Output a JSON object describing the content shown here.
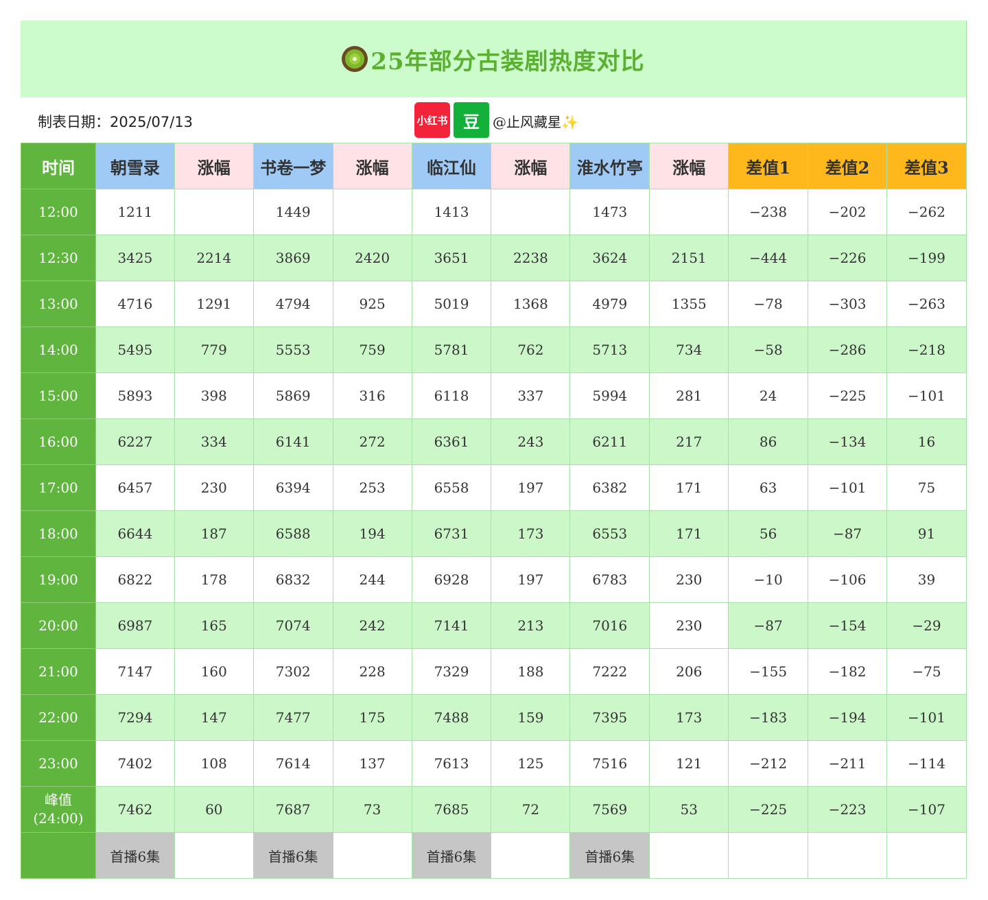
{
  "title": "25年部分古装剧热度对比",
  "date_label": "制表日期：2025/07/13",
  "badges": {
    "xiaohongshu": "小红书",
    "douban": "豆"
  },
  "handle": "@止风藏星",
  "handle_emoji": "✨",
  "colors": {
    "title_band": "#ccfccc",
    "title_text": "#5cb031",
    "time_col": "#5fb53d",
    "drama_header": "#9fcaf6",
    "change_header": "#fde3e5",
    "diff_header": "#ffb81c",
    "alt_row": "#ccf7c9",
    "footer_gray": "#c6c6c6"
  },
  "table": {
    "headers": [
      "时间",
      "朝雪录",
      "涨幅",
      "书卷一梦",
      "涨幅",
      "临江仙",
      "涨幅",
      "淮水竹亭",
      "涨幅",
      "差值1",
      "差值2",
      "差值3"
    ],
    "rows": [
      [
        "12:00",
        "1211",
        "",
        "1449",
        "",
        "1413",
        "",
        "1473",
        "",
        "−238",
        "−202",
        "−262"
      ],
      [
        "12:30",
        "3425",
        "2214",
        "3869",
        "2420",
        "3651",
        "2238",
        "3624",
        "2151",
        "−444",
        "−226",
        "−199"
      ],
      [
        "13:00",
        "4716",
        "1291",
        "4794",
        "925",
        "5019",
        "1368",
        "4979",
        "1355",
        "−78",
        "−303",
        "−263"
      ],
      [
        "14:00",
        "5495",
        "779",
        "5553",
        "759",
        "5781",
        "762",
        "5713",
        "734",
        "−58",
        "−286",
        "−218"
      ],
      [
        "15:00",
        "5893",
        "398",
        "5869",
        "316",
        "6118",
        "337",
        "5994",
        "281",
        "24",
        "−225",
        "−101"
      ],
      [
        "16:00",
        "6227",
        "334",
        "6141",
        "272",
        "6361",
        "243",
        "6211",
        "217",
        "86",
        "−134",
        "16"
      ],
      [
        "17:00",
        "6457",
        "230",
        "6394",
        "253",
        "6558",
        "197",
        "6382",
        "171",
        "63",
        "−101",
        "75"
      ],
      [
        "18:00",
        "6644",
        "187",
        "6588",
        "194",
        "6731",
        "173",
        "6553",
        "171",
        "56",
        "−87",
        "91"
      ],
      [
        "19:00",
        "6822",
        "178",
        "6832",
        "244",
        "6928",
        "197",
        "6783",
        "230",
        "−10",
        "−106",
        "39"
      ],
      [
        "20:00",
        "6987",
        "165",
        "7074",
        "242",
        "7141",
        "213",
        "7016",
        "230",
        "−87",
        "−154",
        "−29"
      ],
      [
        "21:00",
        "7147",
        "160",
        "7302",
        "228",
        "7329",
        "188",
        "7222",
        "206",
        "−155",
        "−182",
        "−75"
      ],
      [
        "22:00",
        "7294",
        "147",
        "7477",
        "175",
        "7488",
        "159",
        "7395",
        "173",
        "−183",
        "−194",
        "−101"
      ],
      [
        "23:00",
        "7402",
        "108",
        "7614",
        "137",
        "7613",
        "125",
        "7516",
        "121",
        "−212",
        "−211",
        "−114"
      ]
    ],
    "peak": {
      "label_line1": "峰值",
      "label_line2": "(24:00)",
      "values": [
        "7462",
        "60",
        "7687",
        "73",
        "7685",
        "72",
        "7569",
        "53",
        "−225",
        "−223",
        "−107"
      ]
    },
    "footer": [
      "",
      "首播6集",
      "",
      "首播6集",
      "",
      "首播6集",
      "",
      "首播6集",
      "",
      "",
      "",
      ""
    ]
  }
}
